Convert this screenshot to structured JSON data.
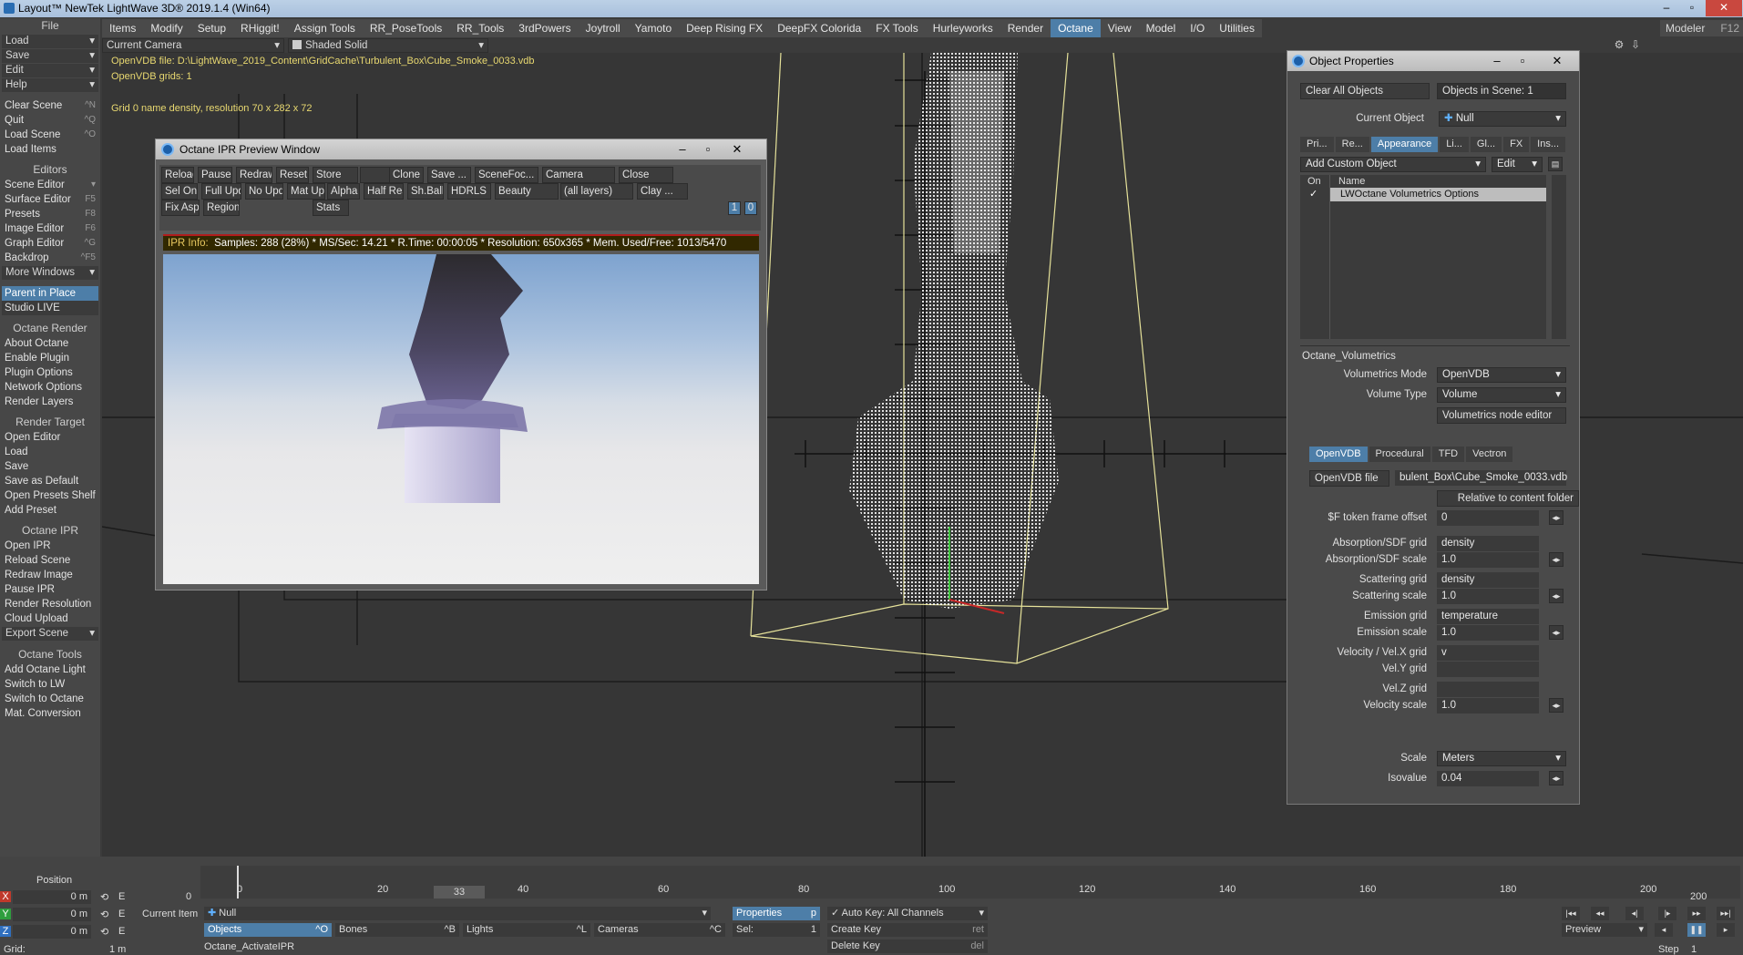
{
  "title": "Layout™ NewTek LightWave 3D® 2019.1.4 (Win64)",
  "window_controls": [
    "–",
    "▫",
    "✕"
  ],
  "menu_tabs": [
    "Items",
    "Modify",
    "Setup",
    "RHiggit!",
    "Assign Tools",
    "RR_PoseTools",
    "RR_Tools",
    "3rdPowers",
    "Joytroll",
    "Yamoto",
    "Deep Rising FX",
    "DeepFX Colorida",
    "FX Tools",
    "Hurleyworks",
    "Render",
    "Octane",
    "View",
    "Model",
    "I/O",
    "Utilities"
  ],
  "active_menu_tab": "Octane",
  "modeler": {
    "label": "Modeler",
    "key": "F12"
  },
  "sidebar": {
    "file_header": "File",
    "file_dropdowns": [
      "Load",
      "Save",
      "Edit",
      "Help"
    ],
    "file_items": [
      {
        "label": "Clear Scene",
        "key": "^N"
      },
      {
        "label": "Quit",
        "key": "^Q"
      },
      {
        "label": "Load Scene",
        "key": "^O"
      },
      {
        "label": "Load Items",
        "key": ""
      }
    ],
    "editors_header": "Editors",
    "editors_items": [
      {
        "label": "Scene Editor",
        "key": "▾"
      },
      {
        "label": "Surface Editor",
        "key": "F5"
      },
      {
        "label": "Presets",
        "key": "F8"
      },
      {
        "label": "Image Editor",
        "key": "F6"
      },
      {
        "label": "Graph Editor",
        "key": "^G"
      },
      {
        "label": "Backdrop",
        "key": "^F5"
      }
    ],
    "more_windows": "More Windows",
    "parent_in_place": "Parent in Place",
    "studio_live": "Studio LIVE",
    "octane_render_header": "Octane Render",
    "octane_render_items": [
      "About Octane",
      "Enable Plugin",
      "Plugin Options",
      "Network Options",
      "Render Layers"
    ],
    "render_target_header": "Render Target",
    "render_target_items": [
      "Open Editor",
      "Load",
      "Save",
      "Save as Default",
      "Open Presets Shelf",
      "Add Preset"
    ],
    "octane_ipr_header": "Octane IPR",
    "octane_ipr_items": [
      "Open IPR",
      "Reload Scene",
      "Redraw Image",
      "Pause IPR",
      "Render Resolution",
      "Cloud Upload"
    ],
    "export_scene": "Export Scene",
    "octane_tools_header": "Octane Tools",
    "octane_tools_items": [
      "Add Octane Light",
      "Switch to LW",
      "Switch to Octane",
      "Mat. Conversion"
    ]
  },
  "viewport": {
    "camera": "Current Camera",
    "shading": "Shaded Solid",
    "info_lines": [
      "OpenVDB file: D:\\LightWave_2019_Content\\GridCache\\Turbulent_Box\\Cube_Smoke_0033.vdb",
      "OpenVDB grids: 1",
      "Grid 0 name density, resolution 70 x 282 x 72"
    ]
  },
  "ipr": {
    "title": "Octane IPR Preview Window",
    "row1": [
      "Reload",
      "Pause",
      "Redraw",
      "Reset",
      "Store",
      "",
      "Clone",
      "Save ...",
      "SceneFoc...",
      "Camera",
      "Close"
    ],
    "row2": [
      "Sel Only",
      "Full Upd.",
      "No Upd.",
      "Mat Upd",
      "Alpha",
      "Half Res",
      "Sh.Ball",
      "HDRLS",
      "Beauty",
      "(all layers)",
      "Clay ..."
    ],
    "row3": [
      "Fix Asp.",
      "Region",
      "Stats"
    ],
    "counters": [
      "1",
      "0"
    ],
    "info_label": "IPR Info:",
    "info_text": "Samples: 288 (28%)  *  MS/Sec: 14.21  *  R.Time: 00:00:05  *  Resolution: 650x365  *  Mem. Used/Free: 1013/5470"
  },
  "object_properties": {
    "title": "Object Properties",
    "clear_all": "Clear All Objects",
    "objects_in_scene": "Objects in Scene: 1",
    "current_object_label": "Current Object",
    "current_object": "Null",
    "tabs": [
      "Pri...",
      "Re...",
      "Appearance",
      "Li...",
      "Gl...",
      "FX",
      "Ins..."
    ],
    "active_tab": "Appearance",
    "add_custom": "Add Custom Object",
    "edit": "Edit",
    "list_headers": [
      "On",
      "Name"
    ],
    "list_rows": [
      {
        "on": "✓",
        "name": "LWOctane Volumetrics Options"
      }
    ],
    "section": "Octane_Volumetrics",
    "volumetrics_mode_label": "Volumetrics Mode",
    "volumetrics_mode": "OpenVDB",
    "volume_type_label": "Volume Type",
    "volume_type": "Volume",
    "node_editor": "Volumetrics node editor",
    "subtabs": [
      "OpenVDB",
      "Procedural",
      "TFD",
      "Vectron"
    ],
    "active_subtab": "OpenVDB",
    "openvdb_file_btn": "OpenVDB file",
    "openvdb_file": "bulent_Box\\Cube_Smoke_0033.vdb",
    "relative": "Relative to content folder",
    "fields": [
      {
        "label": "$F token frame offset",
        "value": "0",
        "arrow": true
      },
      {
        "label": "Absorption/SDF grid",
        "value": "density",
        "arrow": false
      },
      {
        "label": "Absorption/SDF scale",
        "value": "1.0",
        "arrow": true
      },
      {
        "label": "Scattering grid",
        "value": "density",
        "arrow": false
      },
      {
        "label": "Scattering scale",
        "value": "1.0",
        "arrow": true
      },
      {
        "label": "Emission grid",
        "value": "temperature",
        "arrow": false
      },
      {
        "label": "Emission scale",
        "value": "1.0",
        "arrow": true
      },
      {
        "label": "Velocity / Vel.X grid",
        "value": "v",
        "arrow": false
      },
      {
        "label": "Vel.Y grid",
        "value": "",
        "arrow": false
      },
      {
        "label": "Vel.Z grid",
        "value": "",
        "arrow": false
      },
      {
        "label": "Velocity scale",
        "value": "1.0",
        "arrow": true
      }
    ],
    "scale_label": "Scale",
    "scale": "Meters",
    "isovalue_label": "Isovalue",
    "isovalue": "0.04"
  },
  "bottom": {
    "position": "Position",
    "axes": [
      {
        "a": "X",
        "v": "0 m"
      },
      {
        "a": "Y",
        "v": "0 m"
      },
      {
        "a": "Z",
        "v": "0 m"
      }
    ],
    "grid_label": "Grid:",
    "grid_value": "1 m",
    "frame_start": "0",
    "current_frame": "33",
    "end_frame": "200",
    "ticks": [
      "0",
      "20",
      "40",
      "60",
      "80",
      "100",
      "120",
      "140",
      "160",
      "180",
      "200"
    ],
    "current_item_label": "Current Item",
    "current_item": "Null",
    "properties": "Properties",
    "properties_key": "p",
    "auto_key": "Auto Key: All Channels",
    "objects": "Objects",
    "objects_key": "^O",
    "bones": "Bones",
    "bones_key": "^B",
    "lights": "Lights",
    "lights_key": "^L",
    "cameras": "Cameras",
    "cameras_key": "^C",
    "sel_label": "Sel:",
    "sel_value": "1",
    "create_key": "Create Key",
    "create_key_shortcut": "ret",
    "delete_key": "Delete Key",
    "delete_key_shortcut": "del",
    "status": "Octane_ActivateIPR",
    "preview": "Preview",
    "step_label": "Step",
    "step_value": "1"
  },
  "colors": {
    "accent": "#4d7ea8",
    "info_yellow": "#e8d870",
    "bound_box": "#e6e29a"
  }
}
